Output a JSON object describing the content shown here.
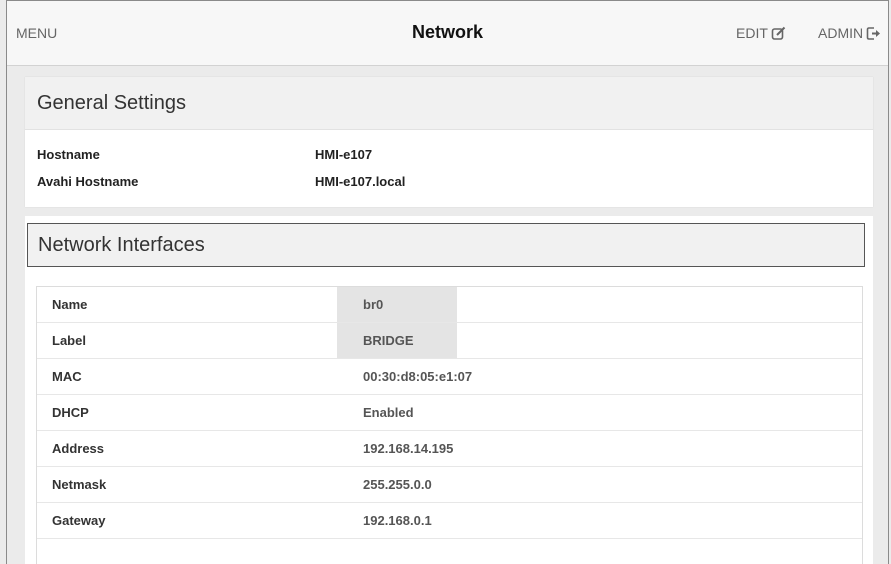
{
  "header": {
    "menu_label": "MENU",
    "title": "Network",
    "edit_label": "EDIT",
    "admin_label": "ADMIN",
    "edit_icon": "edit-icon",
    "admin_icon": "logout-icon"
  },
  "general": {
    "title": "General Settings",
    "rows": [
      {
        "key": "Hostname",
        "value": "HMI-e107"
      },
      {
        "key": "Avahi Hostname",
        "value": "HMI-e107.local"
      }
    ]
  },
  "interfaces": {
    "title": "Network Interfaces",
    "rows": [
      {
        "key": "Name",
        "value": "br0"
      },
      {
        "key": "Label",
        "value": "BRIDGE"
      },
      {
        "key": "MAC",
        "value": "00:30:d8:05:e1:07"
      },
      {
        "key": "DHCP",
        "value": "Enabled"
      },
      {
        "key": "Address",
        "value": "192.168.14.195"
      },
      {
        "key": "Netmask",
        "value": "255.255.0.0"
      },
      {
        "key": "Gateway",
        "value": "192.168.0.1"
      }
    ]
  },
  "colors": {
    "background": "#ebebeb",
    "panel_header": "#f1f1f1",
    "highlight": "#e4e4e4"
  }
}
